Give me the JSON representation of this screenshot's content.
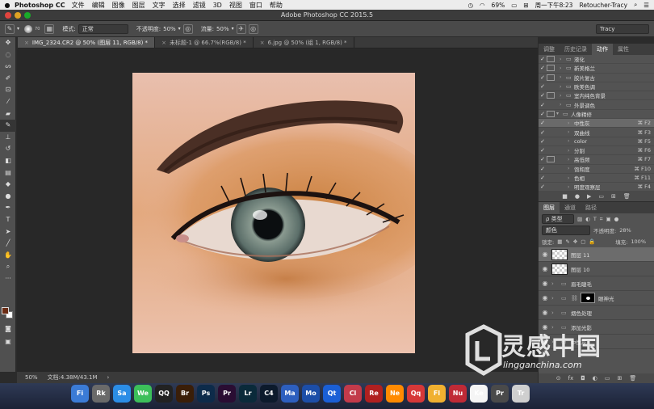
{
  "menubar": {
    "app_name": "Photoshop CC",
    "items": [
      "文件",
      "编辑",
      "图像",
      "图层",
      "文字",
      "选择",
      "滤镜",
      "3D",
      "视图",
      "窗口",
      "帮助"
    ],
    "battery": "69%",
    "clock": "周一下午8:23",
    "user": "Retoucher-Tracy"
  },
  "window": {
    "title": "Adobe Photoshop CC 2015.5"
  },
  "options": {
    "brush_size": "70",
    "mode_label": "模式:",
    "mode_value": "正常",
    "opacity_label": "不透明度:",
    "opacity_value": "50%",
    "flow_label": "流量:",
    "flow_value": "50%",
    "workspace": "Tracy"
  },
  "doc_tabs": [
    {
      "label": "IMG_2324.CR2 @ 50% (图层 11, RGB/8) *"
    },
    {
      "label": "未标题-1 @ 66.7%(RGB/8) *"
    },
    {
      "label": "6.jpg @ 50% (组 1, RGB/8) *"
    }
  ],
  "status": {
    "zoom": "50%",
    "doc": "文档:4.38M/43.1M"
  },
  "actions_panel": {
    "tabs": [
      "调整",
      "历史记录",
      "动作",
      "属性"
    ],
    "active_tab": 2,
    "rows": [
      {
        "name": "液化",
        "key": "",
        "level": 1,
        "dialog": true
      },
      {
        "name": "新美格兰",
        "key": "",
        "level": 1,
        "dialog": true
      },
      {
        "name": "胶片复古",
        "key": "",
        "level": 1,
        "dialog": true
      },
      {
        "name": "欧美色调",
        "key": "",
        "level": 1,
        "dialog": false
      },
      {
        "name": "室内纯色背景",
        "key": "",
        "level": 1,
        "dialog": true
      },
      {
        "name": "外景调色",
        "key": "",
        "level": 1,
        "dialog": false
      },
      {
        "name": "人像精修",
        "key": "",
        "level": 0,
        "dialog": true,
        "open": true
      },
      {
        "name": "中性灰",
        "key": "⌘ F2",
        "level": 2,
        "dialog": false,
        "selected": true
      },
      {
        "name": "双曲线",
        "key": "⌘ F3",
        "level": 2,
        "dialog": false
      },
      {
        "name": "color",
        "key": "⌘ F5",
        "level": 2,
        "dialog": false
      },
      {
        "name": "分割",
        "key": "⌘ F6",
        "level": 2,
        "dialog": false
      },
      {
        "name": "高低频",
        "key": "⌘ F7",
        "level": 2,
        "dialog": true
      },
      {
        "name": "饱和度",
        "key": "⌘ F10",
        "level": 2,
        "dialog": false
      },
      {
        "name": "色相",
        "key": "⌘ F11",
        "level": 2,
        "dialog": false
      },
      {
        "name": "明度观察层",
        "key": "⌘ F4",
        "level": 2,
        "dialog": false
      }
    ]
  },
  "layers_panel": {
    "tabs": [
      "图层",
      "通道",
      "路径"
    ],
    "filter_label": "ρ 类型",
    "blend_mode": "颜色",
    "opacity_label": "不透明度:",
    "opacity_value": "28%",
    "lock_label": "锁定:",
    "fill_label": "填充:",
    "fill_value": "100%",
    "layers": [
      {
        "name": "图层 11",
        "type": "pixel",
        "selected": true
      },
      {
        "name": "图层 10",
        "type": "pixel"
      },
      {
        "name": "眉毛睫毛",
        "type": "group"
      },
      {
        "name": "眼神光",
        "type": "mask"
      },
      {
        "name": "烟色处理",
        "type": "group"
      },
      {
        "name": "添加光影",
        "type": "group"
      },
      {
        "name": "中性灰",
        "type": "group"
      }
    ]
  },
  "watermark": {
    "text": "灵感中国",
    "url": "lingganchina.com"
  },
  "dock": [
    "Fi",
    "Rk",
    "Sa",
    "We",
    "QQ",
    "Br",
    "Ps",
    "Pr",
    "Lr",
    "C4",
    "Ma",
    "Mo",
    "Qt",
    "Cl",
    "Re",
    "Ne",
    "Qq",
    "Fl",
    "Nu",
    "Ke",
    "Pr",
    "Tr"
  ],
  "colors": {
    "foreground": "#6b2c14",
    "background": "#ffffff",
    "accent": "#4d8fd8"
  }
}
